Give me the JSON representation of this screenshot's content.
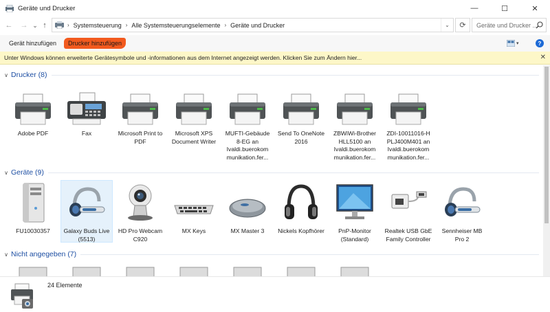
{
  "window": {
    "title": "Geräte und Drucker",
    "minimize_glyph": "—",
    "maximize_glyph": "☐",
    "close_glyph": "✕"
  },
  "nav": {
    "back_glyph": "←",
    "forward_glyph": "→",
    "recent_glyph": "⌄",
    "up_glyph": "↑"
  },
  "address": {
    "breadcrumbs": [
      "Systemsteuerung",
      "Alle Systemsteuerungselemente",
      "Geräte und Drucker"
    ],
    "separator": "›",
    "dropdown_glyph": "⌄",
    "refresh_glyph": "⟳",
    "search_placeholder": "Geräte und Drucker ..."
  },
  "commandbar": {
    "add_device": "Gerät hinzufügen",
    "add_printer": "Drucker hinzufügen",
    "help_glyph": "?"
  },
  "infobar": {
    "text": "Unter Windows können erweiterte Gerätesymbole und -informationen aus dem Internet angezeigt werden. Klicken Sie zum Ändern hier...",
    "close_glyph": "✕"
  },
  "groups": {
    "drucker": {
      "title": "Drucker (8)",
      "chevron": "∨",
      "items": [
        {
          "label": "Adobe PDF",
          "icon": "printer-icon"
        },
        {
          "label": "Fax",
          "icon": "fax-icon"
        },
        {
          "label": "Microsoft Print to PDF",
          "icon": "printer-icon"
        },
        {
          "label": "Microsoft XPS Document Writer",
          "icon": "printer-icon"
        },
        {
          "label": "MUFTI-Gebäude 8-EG an Ivaldi.buerokom munikation.fer...",
          "icon": "printer-icon"
        },
        {
          "label": "Send To OneNote 2016",
          "icon": "printer-icon"
        },
        {
          "label": "ZBWiWi-Brother HLL5100 an Ivaldi.buerokom munikation.fer...",
          "icon": "printer-icon"
        },
        {
          "label": "ZDI-10011016-H PLJ400M401 an Ivaldi.buerokom munikation.fer...",
          "icon": "printer-icon"
        }
      ]
    },
    "geraete": {
      "title": "Geräte (9)",
      "chevron": "∨",
      "items": [
        {
          "label": "FU10030357",
          "icon": "computer-tower-icon"
        },
        {
          "label": "Galaxy Buds Live (5513)",
          "icon": "headset-icon"
        },
        {
          "label": "HD Pro Webcam C920",
          "icon": "webcam-icon"
        },
        {
          "label": "MX Keys",
          "icon": "keyboard-icon"
        },
        {
          "label": "MX Master 3",
          "icon": "mouse-icon"
        },
        {
          "label": "Nickels Kopfhörer",
          "icon": "headphones-icon"
        },
        {
          "label": "PnP-Monitor (Standard)",
          "icon": "monitor-icon"
        },
        {
          "label": "Realtek USB GbE Family Controller",
          "icon": "usb-adapter-icon"
        },
        {
          "label": "Sennheiser MB Pro 2",
          "icon": "headset-icon"
        }
      ]
    },
    "nicht": {
      "title": "Nicht angegeben (7)",
      "chevron": "∨"
    }
  },
  "footer": {
    "count": "24 Elemente"
  },
  "colors": {
    "accent_blue": "#1e4fa3",
    "highlight_orange": "#f25a1e",
    "info_yellow": "#fdf7c8",
    "selection_blue": "#e5f1fb"
  }
}
